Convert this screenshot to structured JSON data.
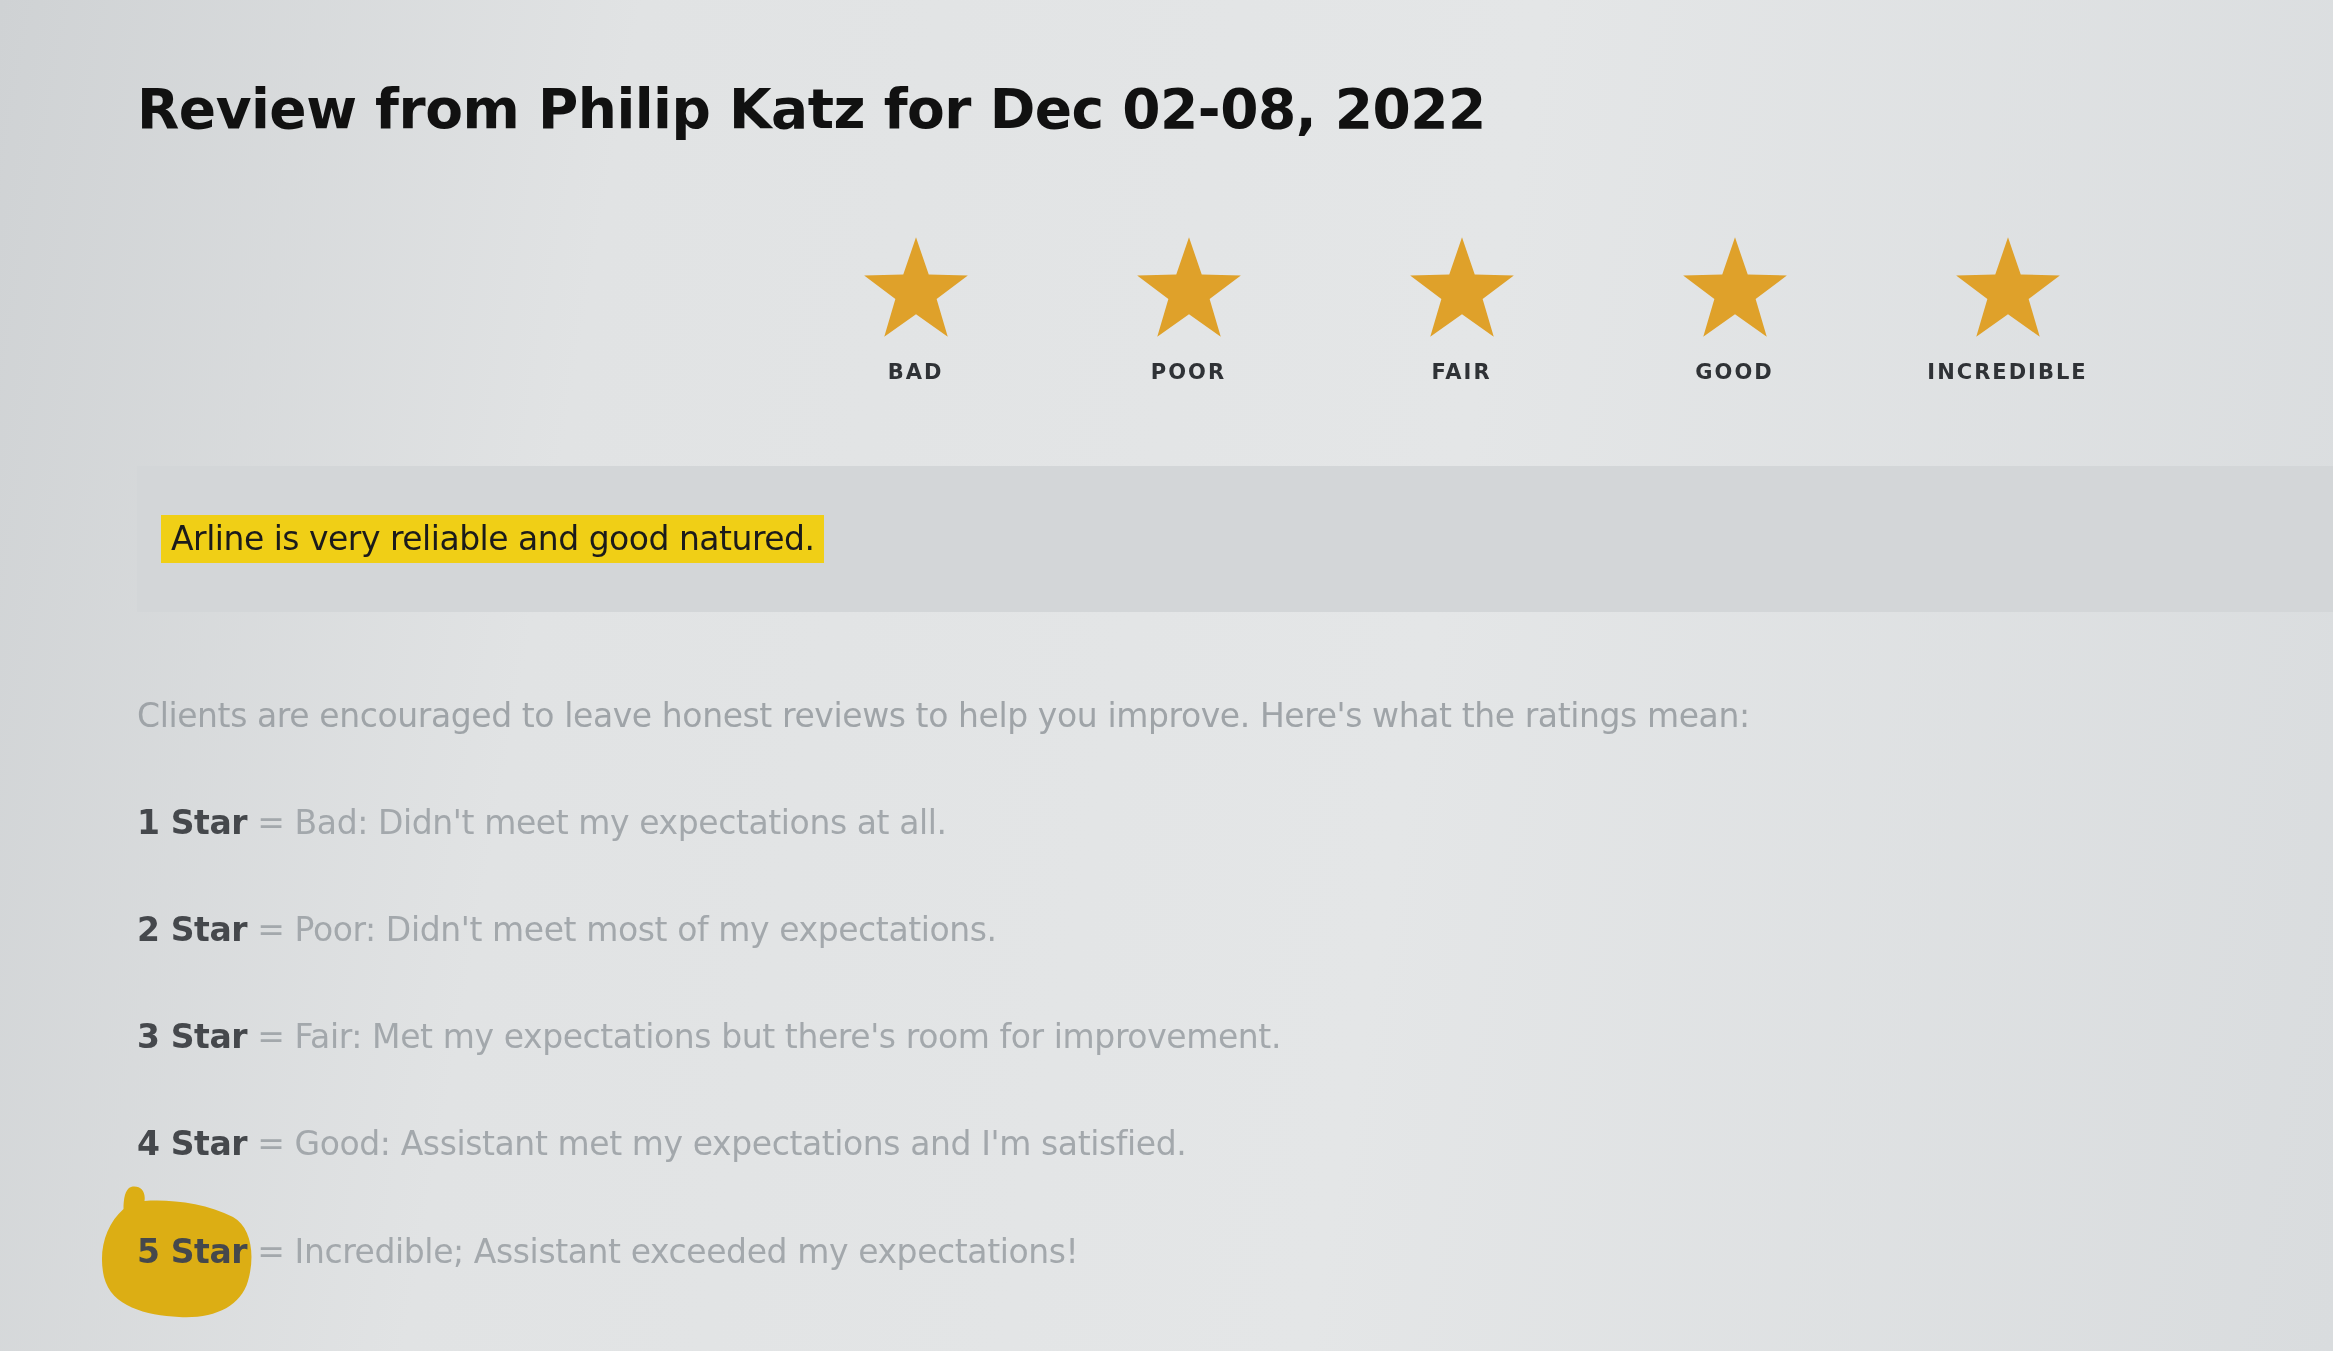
{
  "title": "Review from Philip Katz for Dec 02-08, 2022",
  "rating": {
    "stars": 5,
    "labels": [
      "BAD",
      "POOR",
      "FAIR",
      "GOOD",
      "INCREDIBLE"
    ]
  },
  "comment": {
    "text": "Arline is very reliable and good natured.",
    "highlighted": true
  },
  "legend": {
    "intro": "Clients are encouraged to leave honest reviews to help you improve. Here's what the ratings mean:",
    "lines": [
      {
        "text": "**1 Star** = Bad: Didn't meet my expectations at all.",
        "circled": false
      },
      {
        "text": "**2 Star** = Poor: Didn't meet most of my expectations.",
        "circled": false
      },
      {
        "text": "**3 Star** = Fair: Met my expectations but there's room for improvement.",
        "circled": false
      },
      {
        "text": "**4 Star** = Good: Assistant met my expectations and I'm satisfied.",
        "circled": false
      },
      {
        "text": "**5 Star** = Incredible; Assistant exceeded my expectations!",
        "circled": true
      }
    ]
  }
}
